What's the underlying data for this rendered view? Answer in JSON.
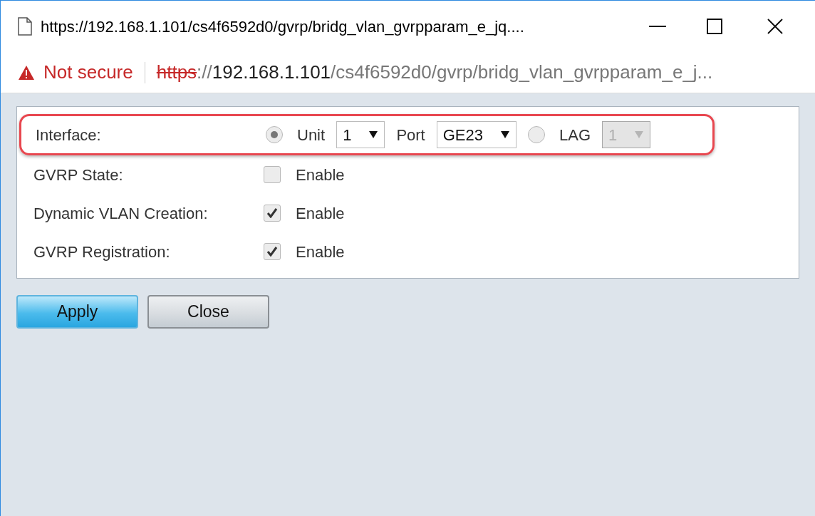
{
  "window": {
    "title": "https://192.168.1.101/cs4f6592d0/gvrp/bridg_vlan_gvrpparam_e_jq...."
  },
  "address_bar": {
    "security": "Not secure",
    "scheme": "https",
    "separator": "://",
    "host": "192.168.1.101",
    "path": "/cs4f6592d0/gvrp/bridg_vlan_gvrpparam_e_j..."
  },
  "interface": {
    "label": "Interface:",
    "highlighted": true,
    "items": [
      {
        "kind": "radio",
        "label": "Unit",
        "selected": true
      },
      {
        "kind": "select",
        "value": "1",
        "disabled": false
      },
      {
        "kind": "text",
        "label": "Port"
      },
      {
        "kind": "select",
        "value": "GE23",
        "disabled": false
      },
      {
        "kind": "radio",
        "label": "LAG",
        "selected": false
      },
      {
        "kind": "select",
        "value": "1",
        "disabled": true
      }
    ]
  },
  "rows": [
    {
      "label": "GVRP State:",
      "option": "Enable",
      "checked": false
    },
    {
      "label": "Dynamic VLAN Creation:",
      "option": "Enable",
      "checked": true
    },
    {
      "label": "GVRP Registration:",
      "option": "Enable",
      "checked": true
    }
  ],
  "buttons": [
    {
      "label": "Apply",
      "primary": true
    },
    {
      "label": "Close",
      "primary": false
    }
  ]
}
